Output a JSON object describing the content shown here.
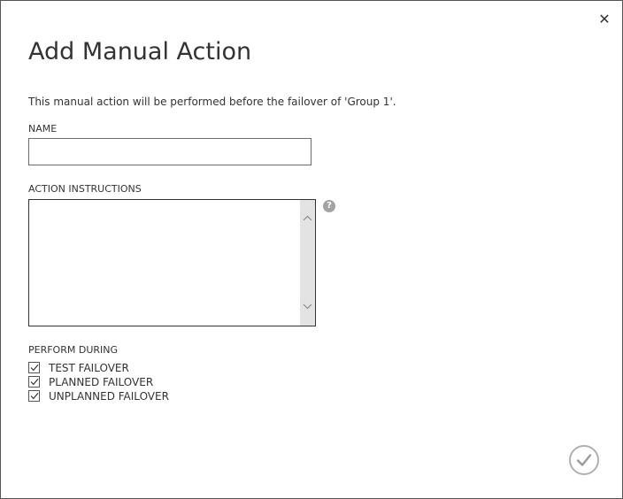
{
  "dialog": {
    "title": "Add Manual Action",
    "close_icon": "close-icon",
    "description": "This manual action will be performed before the failover of 'Group 1'."
  },
  "name_field": {
    "label": "NAME",
    "value": "",
    "placeholder": ""
  },
  "instructions_field": {
    "label": "ACTION INSTRUCTIONS",
    "value": "",
    "help_icon": "help-icon",
    "help_glyph": "?"
  },
  "perform_during": {
    "label": "PERFORM DURING",
    "options": [
      {
        "label": "TEST FAILOVER",
        "checked": true
      },
      {
        "label": "PLANNED FAILOVER",
        "checked": true
      },
      {
        "label": "UNPLANNED FAILOVER",
        "checked": true
      }
    ]
  },
  "footer": {
    "ok_icon": "checkmark-icon"
  },
  "colors": {
    "border": "#555555",
    "text": "#333333",
    "scrollbar": "#e3e3e3",
    "help_icon": "#a3a3a3",
    "ok_ring": "#b0b0b0"
  }
}
